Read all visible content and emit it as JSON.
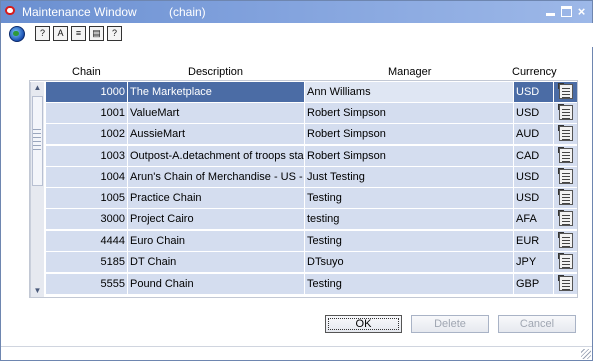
{
  "window": {
    "title": "Maintenance Window",
    "subtitle": "(chain)",
    "controls": {
      "minimize": "minimize",
      "maximize": "maximize",
      "close": "×"
    }
  },
  "toolbar": {
    "buttons": [
      {
        "name": "globe",
        "label": ""
      },
      {
        "name": "help-topics",
        "label": "?"
      },
      {
        "name": "spell",
        "label": "A"
      },
      {
        "name": "doc",
        "label": "≡"
      },
      {
        "name": "print",
        "label": "▤"
      },
      {
        "name": "help",
        "label": "?"
      }
    ]
  },
  "table": {
    "headers": {
      "chain": "Chain",
      "description": "Description",
      "manager": "Manager",
      "currency": "Currency"
    },
    "rows": [
      {
        "chain": "1000",
        "description": "The Marketplace",
        "manager": "Ann Williams",
        "currency": "USD"
      },
      {
        "chain": "1001",
        "description": "ValueMart",
        "manager": "Robert Simpson",
        "currency": "USD"
      },
      {
        "chain": "1002",
        "description": "AussieMart",
        "manager": "Robert Simpson",
        "currency": "AUD"
      },
      {
        "chain": "1003",
        "description": "Outpost-A.detachment of troops sta",
        "manager": "Robert Simpson",
        "currency": "CAD"
      },
      {
        "chain": "1004",
        "description": "Arun's Chain of Merchandise - US - I",
        "manager": "Just Testing",
        "currency": "USD"
      },
      {
        "chain": "1005",
        "description": "Practice Chain",
        "manager": "Testing",
        "currency": "USD"
      },
      {
        "chain": "3000",
        "description": "Project Cairo",
        "manager": "testing",
        "currency": "AFA"
      },
      {
        "chain": "4444",
        "description": "Euro Chain",
        "manager": "Testing",
        "currency": "EUR"
      },
      {
        "chain": "5185",
        "description": "DT Chain",
        "manager": "DTsuyo",
        "currency": "JPY"
      },
      {
        "chain": "5555",
        "description": "Pound Chain",
        "manager": "Testing",
        "currency": "GBP"
      }
    ],
    "selected_index": 0
  },
  "buttons": {
    "ok": "OK",
    "delete": "Delete",
    "cancel": "Cancel"
  }
}
